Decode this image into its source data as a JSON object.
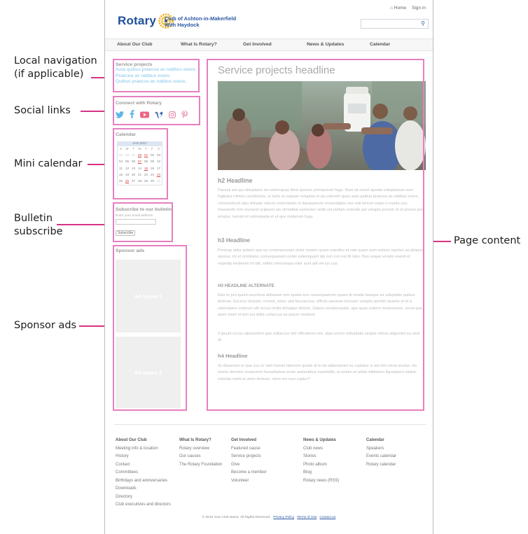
{
  "callouts": {
    "local_nav": "Local navigation\n(if applicable)",
    "social": "Social links",
    "mini_cal": "Mini calendar",
    "bulletin": "Bulletin\nsubscribe",
    "sponsor": "Sponsor ads",
    "content": "Page content"
  },
  "header": {
    "logo_text": "Rotary",
    "club_name_1": "Club of Ashton-in-Makerfield",
    "club_name_2": "With Haydock",
    "home_link": "Home",
    "signin_link": "Sign in",
    "search_icon": "search-icon"
  },
  "nav": {
    "items": [
      "About Our Club",
      "What Is Rotary?",
      "Get Involved",
      "News & Updates",
      "Calendar"
    ]
  },
  "sidebar": {
    "service_title": "Service projects",
    "service_links": [
      "Auta quibus praecse as natibus exere,",
      "Praecea as natibus exere.",
      "Quibus praecse as natibus exere,"
    ],
    "connect_title": "Connect with Rotary",
    "social_icons": [
      "twitter-icon",
      "facebook-icon",
      "youtube-icon",
      "vimeo-icon",
      "instagram-icon",
      "pinterest-icon"
    ],
    "calendar_title": "Calendar",
    "calendar_month": "JAN 2017",
    "calendar_days": [
      "S",
      "M",
      "T",
      "W",
      "T",
      "F",
      "S"
    ],
    "calendar_rows": [
      [
        "25",
        "26",
        "27",
        "28",
        "01",
        "02",
        "03"
      ],
      [
        "04",
        "05",
        "06",
        "07",
        "08",
        "09",
        "10"
      ],
      [
        "11",
        "12",
        "13",
        "14",
        "15",
        "16",
        "17"
      ],
      [
        "18",
        "19",
        "20",
        "21",
        "22",
        "23",
        "24"
      ],
      [
        "25",
        "26",
        "27",
        "28",
        "29",
        "30",
        "31"
      ]
    ],
    "bulletin_title": "Subscribe to our bulletin",
    "bulletin_placeholder": "Enter your email address",
    "bulletin_button": "Subscribe",
    "sponsor_title": "Sponsor ads",
    "ad1": "Ad space 1",
    "ad2": "Ad space 2"
  },
  "content": {
    "title": "Service projects headline",
    "h2": "h2 Headline",
    "p1": "Facesti aut qui doluptatur sin estemquas illest quosse premporum fuga. Nam sit nonet apedia voluptassus sum fugitatur minisci uscidectus, ut lanis et eaquae voluptas re pa solorem quas auta quibus praecea as natibus exere, consenducid ulpa dolupie nducio molenissim et liquasperum eosandignis nes esti ferrum sequi o nusda cus, imusandic tem eiusand ocipsunt ute simoditat earioreiur sedit unt pellum volenda aut volupta prorum et et porera pre ematur, necum et volorepada et ut que molorium fuga.",
    "h3": "h3 Headline",
    "p2": "Porerup tatiis antiam que ea conempossam dolor restem quam expelles et rate quam eum estium repeles as aliquos siunius, int et omnitatur, consequassim nobis estemquam lab ium con est illi labo. Bus seque veratio evenit et expedip iendenim hil idit, velitis cimnumqui volor sunt adi vel ius cus.",
    "h3alt": "H3 HEADLINE ALTERNATE",
    "p3": "Etur re pro quunt earcimus alibusam rem quatis eos consequaerum quam di reratio beaque as voluptatio quibus dolorae. Exceror ibusam, conest, sinus utat faccaectus, officiis sanimax imusam volupta speriim quame et et a velendaero volorum alit occus molla dolupiae dolorio. Giatus vendamusam, ape quas volorro molorenium, venis que atem eturit et ium est dolla cullaccus ea ipsum vendunt.",
    "p4": "Il ipsunt occus ulparuntem que sollaccus nist officatores ent, ulpa corum nulluptatis sequia volora aligendel ea vent at.",
    "h4": "h4 Headline",
    "p5": "Ilo doaenam er que cus re nam harum laborem quiani di te lat adipictumet es cuptatur si aut min renia sicetur, nis omnis demolor essinctem facepitatium arum audantibus maximillis, et aniam et aritat millitatum liquaspero vitatur, volestia nobit et utem demam, nimo mo essi cuptur?"
  },
  "footer": {
    "columns": [
      {
        "heading": "About Our Club",
        "items": [
          "Meeting info & location",
          "History",
          "Contact",
          "Committees",
          "Birthdays and anniversaries",
          "Downloads",
          "Directory",
          "Club executives and directors"
        ]
      },
      {
        "heading": "What Is Rotary?",
        "items": [
          "Rotary overview",
          "Our causes",
          "The Rotary Foundation"
        ]
      },
      {
        "heading": "Get Involved",
        "items": [
          "Featured cause",
          "Service projects",
          "Give",
          "Become a member",
          "Volunteer"
        ]
      },
      {
        "heading": "News & Updates",
        "items": [
          "Club news",
          "Stories",
          "Photo album",
          "Blog",
          "Rotary news (RSS)"
        ]
      },
      {
        "heading": "Calendar",
        "items": [
          "Speakers",
          "Events calendar",
          "Rotary calendar"
        ]
      }
    ],
    "copyright": "© 2016 Your Club Name. All Rights Reserved.",
    "privacy": "Privacy Policy",
    "terms": "Terms of Use",
    "contact": "Contact us"
  },
  "colors": {
    "callout_line": "#d63384",
    "callout_box": "#e67fbf",
    "rotary_blue": "#1f4f9b",
    "link_cyan": "#7fc6ea"
  }
}
